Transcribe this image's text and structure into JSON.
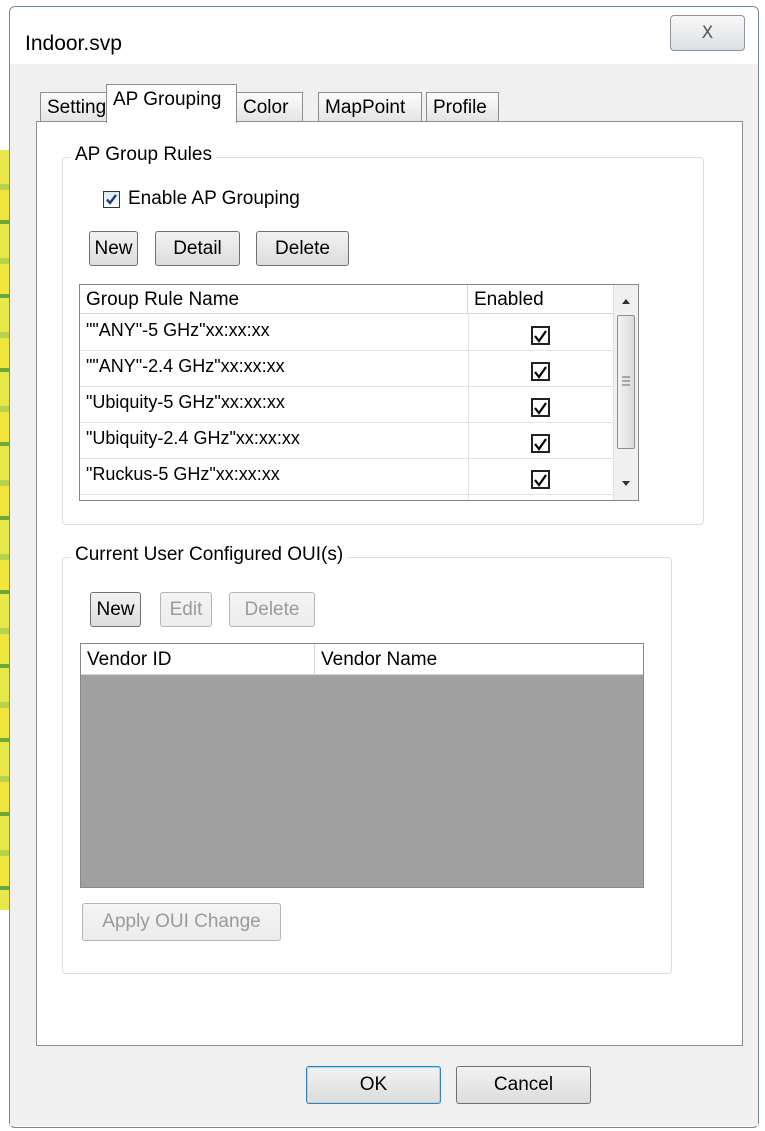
{
  "window": {
    "title": "Indoor.svp",
    "close_glyph": "X",
    "close_icon": "close-icon"
  },
  "tabs": [
    {
      "label": "Settings",
      "active": false
    },
    {
      "label": "AP Grouping",
      "active": true
    },
    {
      "label": "Color",
      "active": false
    },
    {
      "label": "MapPoint",
      "active": false
    },
    {
      "label": "Profile",
      "active": false
    }
  ],
  "ap_group_rules": {
    "label": "AP Group Rules",
    "enable_label": "Enable AP Grouping",
    "enable_checked": true,
    "buttons": {
      "new": "New",
      "detail": "Detail",
      "delete": "Delete"
    },
    "columns": {
      "name": "Group Rule Name",
      "enabled": "Enabled"
    },
    "rows": [
      {
        "name": "\"\"ANY\"-5 GHz\"xx:xx:xx",
        "enabled": true
      },
      {
        "name": "\"\"ANY\"-2.4 GHz\"xx:xx:xx",
        "enabled": true
      },
      {
        "name": "\"Ubiquity-5 GHz\"xx:xx:xx",
        "enabled": true
      },
      {
        "name": "\"Ubiquity-2.4 GHz\"xx:xx:xx",
        "enabled": true
      },
      {
        "name": "\"Ruckus-5 GHz\"xx:xx:xx",
        "enabled": true
      }
    ],
    "scroll_icons": {
      "up": "scroll-up-arrow-icon",
      "down": "scroll-down-arrow-icon",
      "grip": "scroll-grip-icon"
    }
  },
  "oui": {
    "label": "Current User Configured OUI(s)",
    "buttons": {
      "new": "New",
      "edit": "Edit",
      "delete": "Delete"
    },
    "columns": {
      "vendor_id": "Vendor ID",
      "vendor_name": "Vendor Name"
    },
    "rows": [],
    "apply_label": "Apply OUI Change"
  },
  "dialog_buttons": {
    "ok": "OK",
    "cancel": "Cancel"
  },
  "colors": {
    "accent": "#3c7fb1",
    "empty_list_bg": "#a0a0a0"
  }
}
